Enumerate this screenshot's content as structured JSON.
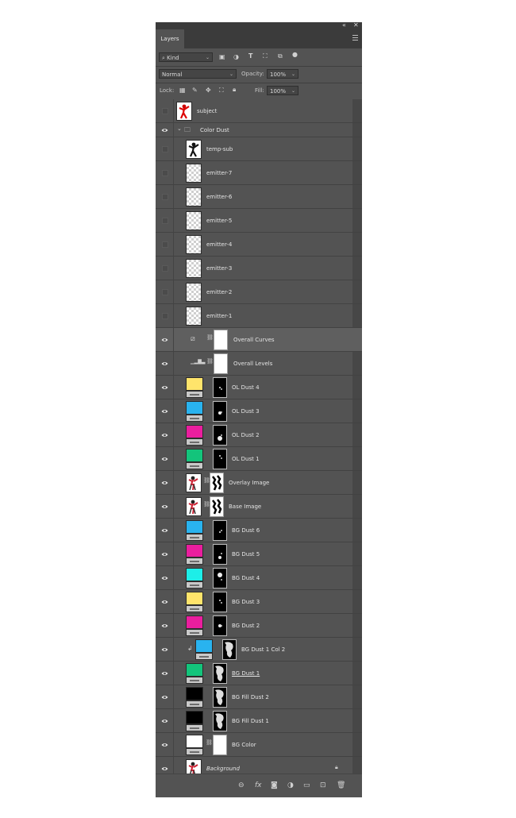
{
  "panel": {
    "tab_label": "Layers",
    "collapse_icon": "double-chevron-icon",
    "close_icon": "close-icon"
  },
  "filter": {
    "kind_label": "Kind",
    "icons": [
      "image-filter-icon",
      "adjustment-filter-icon",
      "type-filter-icon",
      "shape-filter-icon",
      "smart-object-filter-icon",
      "filter-toggle-icon"
    ]
  },
  "blend": {
    "mode": "Normal",
    "opacity_label": "Opacity:",
    "opacity_value": "100%"
  },
  "lock": {
    "label": "Lock:",
    "fill_label": "Fill:",
    "fill_value": "100%"
  },
  "layers": [
    {
      "name": "subject",
      "visible": false,
      "kind": "image",
      "thumb": "subject"
    },
    {
      "name": "Color Dust",
      "visible": true,
      "kind": "group"
    },
    {
      "name": "temp-sub",
      "visible": false,
      "kind": "image",
      "thumb": "silhouette"
    },
    {
      "name": "emitter-7",
      "visible": false,
      "kind": "image",
      "thumb": "transparent"
    },
    {
      "name": "emitter-6",
      "visible": false,
      "kind": "image",
      "thumb": "transparent"
    },
    {
      "name": "emitter-5",
      "visible": false,
      "kind": "image",
      "thumb": "transparent"
    },
    {
      "name": "emitter-4",
      "visible": false,
      "kind": "image",
      "thumb": "transparent"
    },
    {
      "name": "emitter-3",
      "visible": false,
      "kind": "image",
      "thumb": "transparent"
    },
    {
      "name": "emitter-2",
      "visible": false,
      "kind": "image",
      "thumb": "transparent"
    },
    {
      "name": "emitter-1",
      "visible": false,
      "kind": "image",
      "thumb": "transparent"
    },
    {
      "name": "Overall Curves",
      "visible": true,
      "kind": "curves",
      "selected": true
    },
    {
      "name": "Overall Levels",
      "visible": true,
      "kind": "levels"
    },
    {
      "name": "OL Dust 4",
      "visible": true,
      "kind": "fill",
      "color": "#ffe46b"
    },
    {
      "name": "OL Dust 3",
      "visible": true,
      "kind": "fill",
      "color": "#29b3ef"
    },
    {
      "name": "OL Dust 2",
      "visible": true,
      "kind": "fill",
      "color": "#ea1e9e"
    },
    {
      "name": "OL Dust 1",
      "visible": true,
      "kind": "fill",
      "color": "#13c47b"
    },
    {
      "name": "Overlay Image",
      "visible": true,
      "kind": "smart",
      "thumb": "figure"
    },
    {
      "name": "Base Image",
      "visible": true,
      "kind": "smart",
      "thumb": "figure"
    },
    {
      "name": "BG Dust 6",
      "visible": true,
      "kind": "fill",
      "color": "#29b3ef"
    },
    {
      "name": "BG Dust 5",
      "visible": true,
      "kind": "fill",
      "color": "#ea1e9e"
    },
    {
      "name": "BG Dust 4",
      "visible": true,
      "kind": "fill",
      "color": "#1deee8"
    },
    {
      "name": "BG Dust 3",
      "visible": true,
      "kind": "fill",
      "color": "#ffe46b"
    },
    {
      "name": "BG Dust 2",
      "visible": true,
      "kind": "fill",
      "color": "#ea1e9e"
    },
    {
      "name": "BG Dust 1 Col 2",
      "visible": true,
      "kind": "fill",
      "color": "#29b3ef",
      "clipped": true
    },
    {
      "name": "BG Dust 1",
      "visible": true,
      "kind": "fill",
      "color": "#13c47b",
      "underlined": true
    },
    {
      "name": "BG Fill Dust 2",
      "visible": true,
      "kind": "fill",
      "color": "#000000"
    },
    {
      "name": "BG Fill Dust 1",
      "visible": true,
      "kind": "fill",
      "color": "#000000"
    },
    {
      "name": "BG Color",
      "visible": true,
      "kind": "fill",
      "color": "#ffffff"
    },
    {
      "name": "Background",
      "visible": true,
      "kind": "background",
      "thumb": "figure",
      "locked": true
    }
  ],
  "bottom_icons": [
    "link-layers-icon",
    "fx-icon",
    "add-mask-icon",
    "new-adjustment-icon",
    "new-group-icon",
    "new-layer-icon",
    "delete-layer-icon"
  ]
}
